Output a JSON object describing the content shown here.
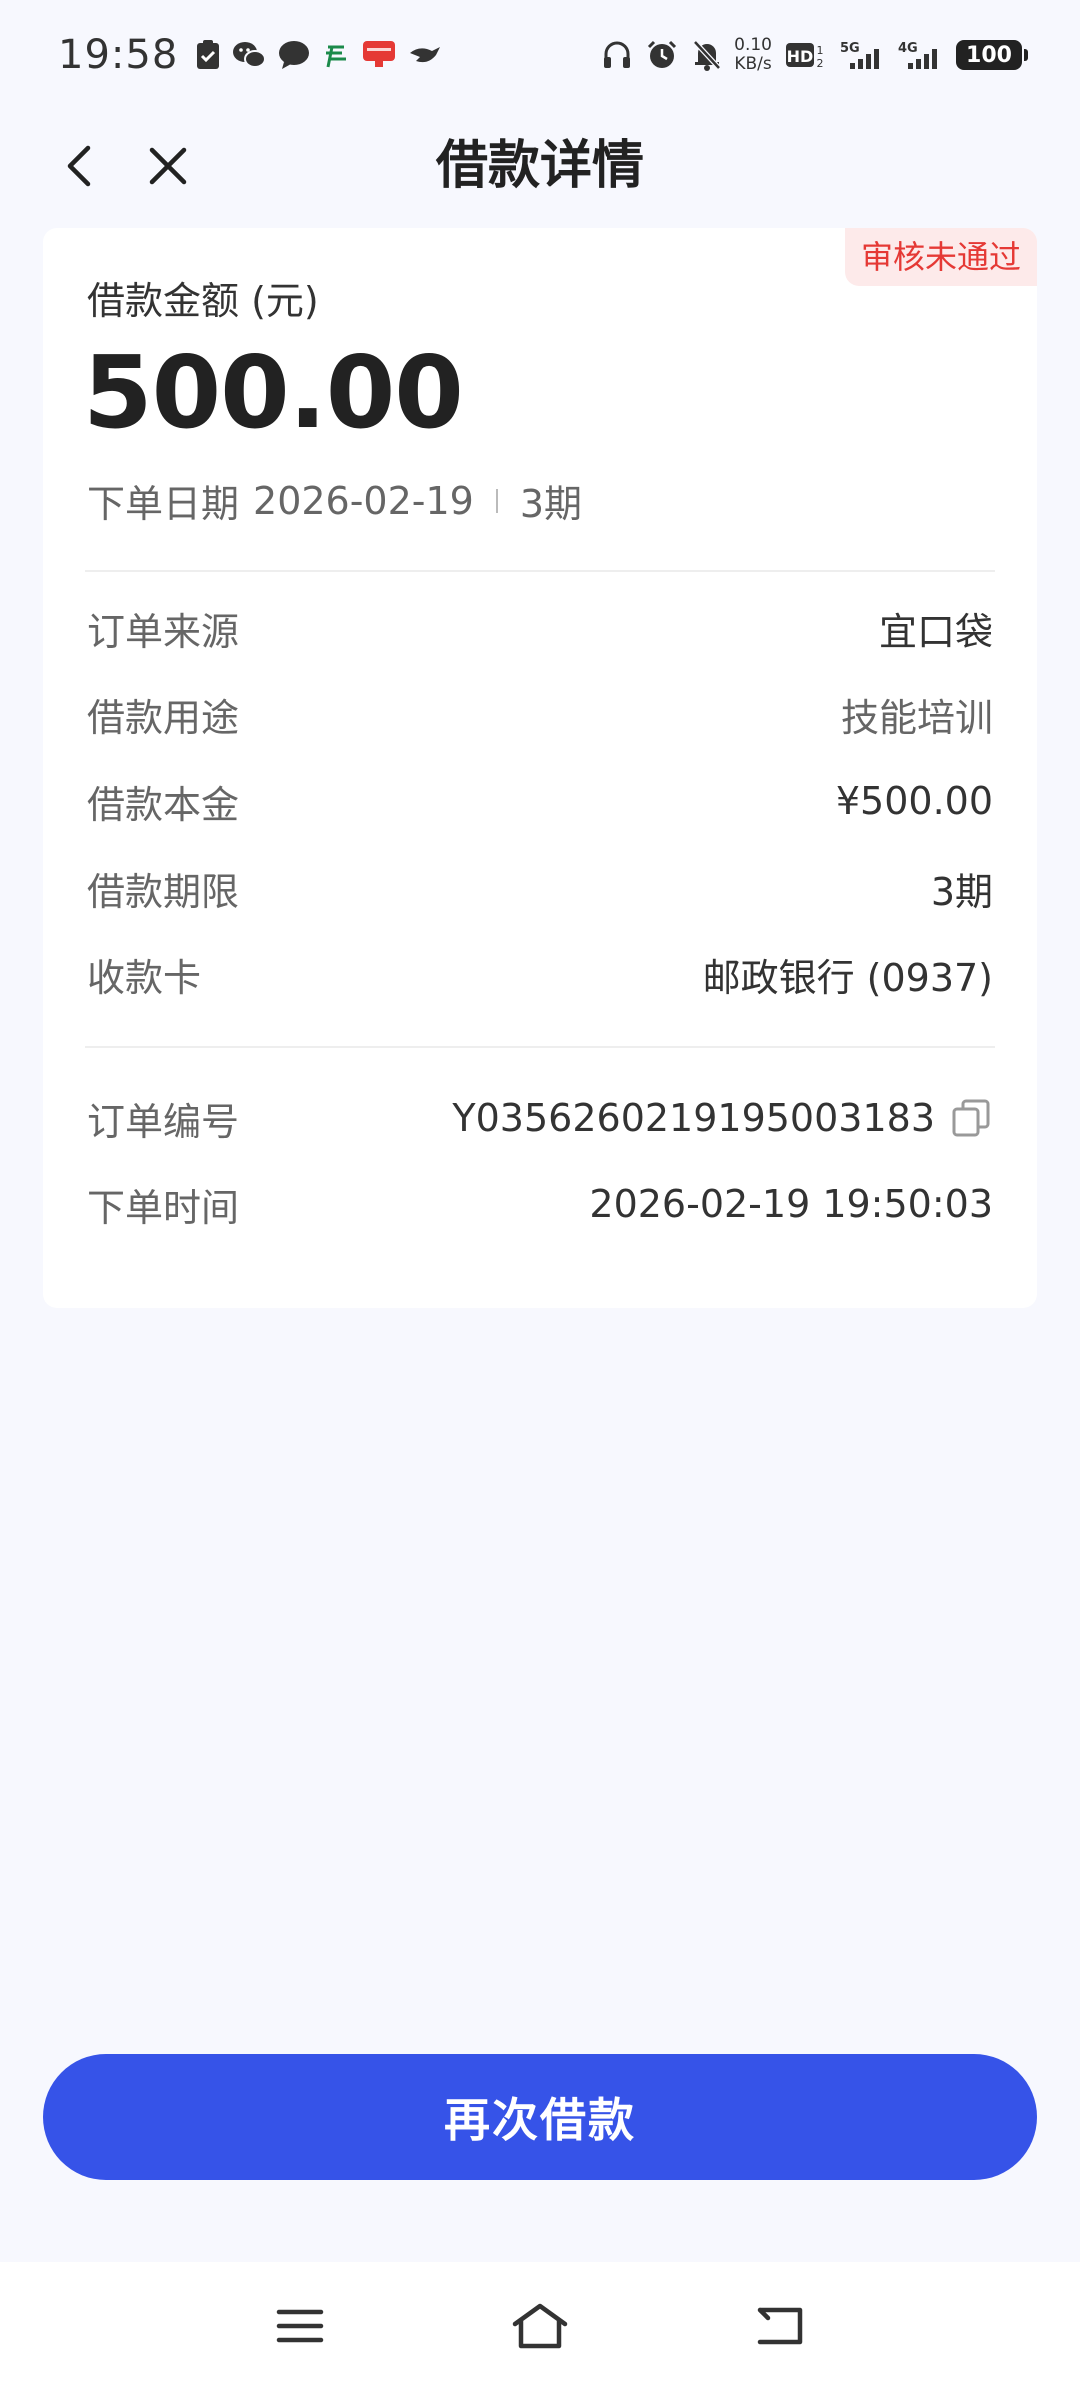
{
  "status_bar": {
    "time": "19:58",
    "net_speed_value": "0.10",
    "net_speed_unit": "KB/s",
    "hd_label": "HD",
    "signal_5g": "5G",
    "signal_4g": "4G",
    "battery": "100"
  },
  "nav": {
    "title": "借款详情"
  },
  "card": {
    "status_tag": "审核未通过",
    "amount_label": "借款金额 (元)",
    "amount_value": "500.00",
    "order_date_label": "下单日期",
    "order_date": "2026-02-19",
    "period": "3期",
    "details": [
      {
        "label": "订单来源",
        "value": "宜口袋"
      },
      {
        "label": "借款用途",
        "value": "技能培训"
      },
      {
        "label": "借款本金",
        "value": "¥500.00"
      },
      {
        "label": "借款期限",
        "value": "3期"
      },
      {
        "label": "收款卡",
        "value": "邮政银行 (0937)"
      }
    ],
    "order_no_label": "订单编号",
    "order_no": "Y035626021919500318 3",
    "order_time_label": "下单时间",
    "order_time": "2026-02-19 19:50:03"
  },
  "actions": {
    "borrow_again": "再次借款"
  },
  "colors": {
    "accent": "#3653e8",
    "status_red": "#e53935",
    "status_red_bg": "#fdeaea",
    "page_bg": "#f7f8fe"
  }
}
